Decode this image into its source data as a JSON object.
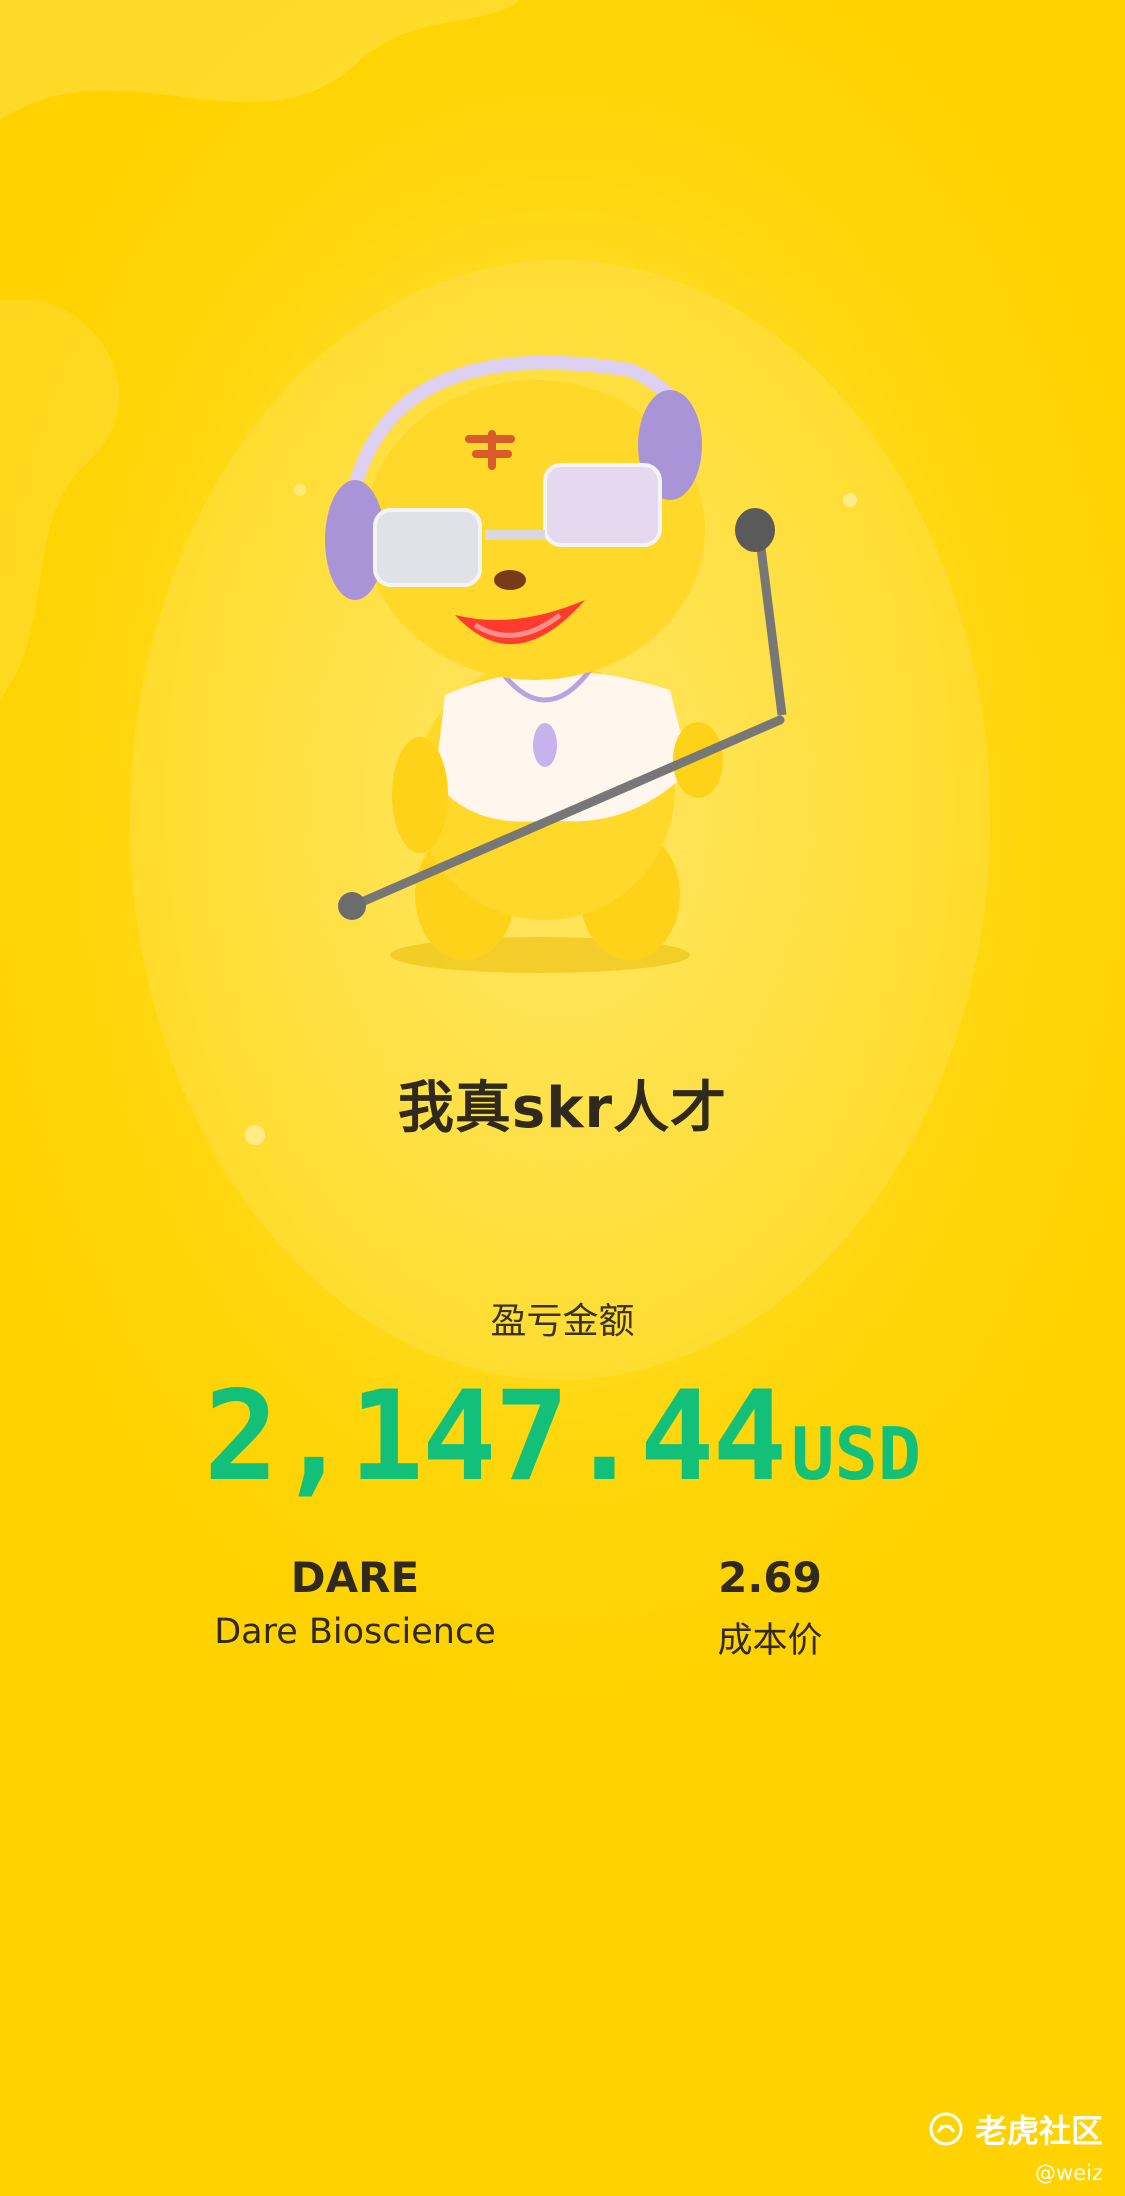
{
  "slogan": "我真skr人才",
  "profit": {
    "label": "盈亏金额",
    "value": "2,147.44",
    "currency": "USD"
  },
  "stock": {
    "symbol": "DARE",
    "name": "Dare Bioscience"
  },
  "cost": {
    "value": "2.69",
    "label": "成本价"
  },
  "watermark": {
    "brand": "老虎社区",
    "handle": "@weiz"
  },
  "colors": {
    "background": "#ffd60a",
    "profit_text": "#13c07a",
    "dark_text": "#2f2a1d"
  },
  "icons": [
    "tiger-mascot-illustration",
    "tiger-community-logo-icon"
  ]
}
